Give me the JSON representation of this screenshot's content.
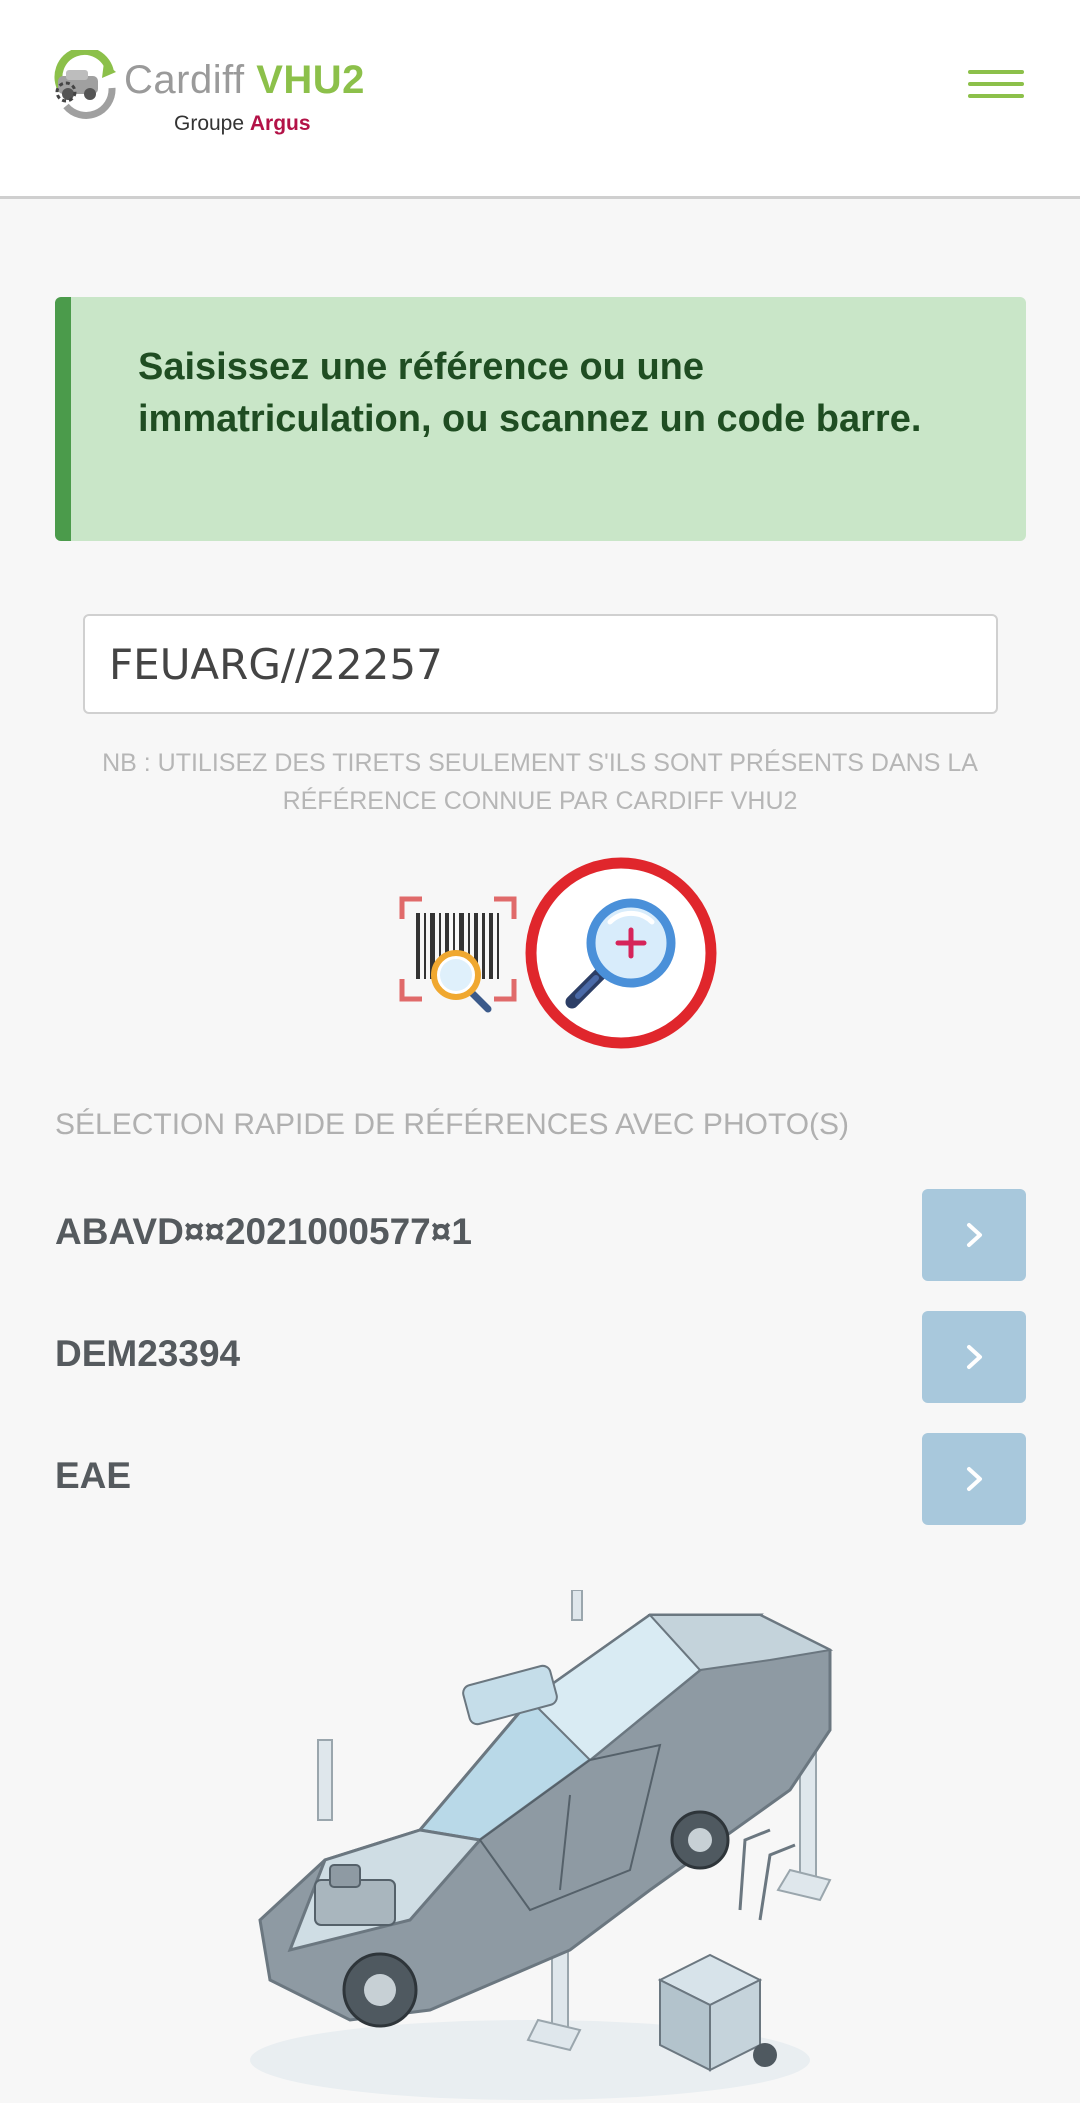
{
  "header": {
    "logo_cardiff": "Cardiff",
    "logo_vhu2": "VHU2",
    "logo_groupe": "Groupe",
    "logo_argus": "Argus",
    "menu_icon": "hamburger-menu-icon"
  },
  "info": {
    "message": "Saisissez une référence ou une immatriculation, ou scannez un code barre."
  },
  "search": {
    "value": "FEUARG//22257",
    "note": "NB : Utilisez des tirets seulement s'ils sont présents dans la référence connue par CARDIFF VHU2",
    "scan_icon": "barcode-scan-icon",
    "search_icon": "magnifier-plus-icon"
  },
  "quick": {
    "title": "SÉLECTION RAPIDE DE RÉFÉRENCES AVEC PHOTO(S)",
    "items": [
      {
        "label": "ABAVD¤¤2021000577¤1"
      },
      {
        "label": "DEM23394"
      },
      {
        "label": "EAE"
      }
    ],
    "arrow_icon": "chevron-right-icon"
  },
  "colors": {
    "brand_green": "#8cc04a",
    "argus_red": "#b31247",
    "info_bg": "#c9e6c8",
    "info_border": "#4b9b4b",
    "button_blue": "#a8c8dc",
    "highlight_red": "#e0262c"
  }
}
